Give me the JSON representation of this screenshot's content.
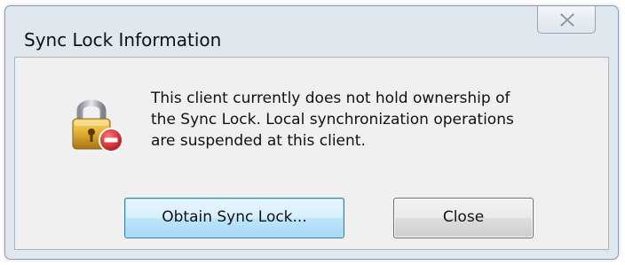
{
  "window": {
    "title": "Sync Lock Information",
    "close_icon": "close-x-icon"
  },
  "icons": {
    "main": "padlock-icon",
    "badge": "no-entry-badge-icon"
  },
  "message": {
    "lines": [
      "This client currently does not hold ownership of",
      "the Sync Lock. Local synchronization operations",
      "are suspended at this client."
    ]
  },
  "buttons": {
    "obtain_label": "Obtain Sync Lock...",
    "close_label": "Close"
  },
  "colors": {
    "client_bg": "#f0f0f0",
    "frame_bg": "#dfe7ef",
    "primary_border": "#3c7fb1",
    "badge_red": "#d8343a"
  }
}
